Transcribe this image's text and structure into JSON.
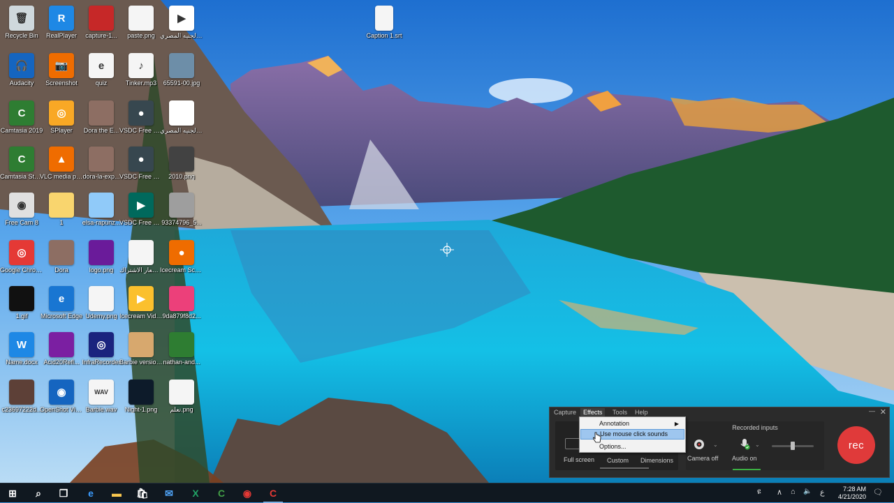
{
  "desktop_icons": [
    {
      "label": "Recycle Bin",
      "icon": "recycle-bin-icon",
      "color": "#cfd8dc",
      "glyph": "🗑"
    },
    {
      "label": "RealPlayer",
      "icon": "realplayer-icon",
      "color": "#1e88e5",
      "glyph": "R"
    },
    {
      "label": "capture-1...",
      "icon": "image-file-icon",
      "color": "#c62828",
      "glyph": ""
    },
    {
      "label": "paste.png",
      "icon": "image-file-icon",
      "color": "#f5f5f5",
      "glyph": ""
    },
    {
      "label": "الجنيه المصري.wmv",
      "icon": "video-file-icon",
      "color": "#ffffff",
      "glyph": "▶"
    },
    {
      "label": "Audacity",
      "icon": "audacity-icon",
      "color": "#1565c0",
      "glyph": "🎧"
    },
    {
      "label": "Screenshot",
      "icon": "screenshot-icon",
      "color": "#ef6c00",
      "glyph": "📷"
    },
    {
      "label": "quiz",
      "icon": "quiz-file-icon",
      "color": "#f5f5f5",
      "glyph": "e"
    },
    {
      "label": "Tinker.mp3",
      "icon": "audio-file-icon",
      "color": "#f5f5f5",
      "glyph": "♪"
    },
    {
      "label": "65591-00.jpg",
      "icon": "image-file-icon",
      "color": "#6d8ea8",
      "glyph": ""
    },
    {
      "label": "Camtasia 2019",
      "icon": "camtasia-icon",
      "color": "#2e7d32",
      "glyph": "C"
    },
    {
      "label": "SPlayer",
      "icon": "splayer-icon",
      "color": "#f9a825",
      "glyph": "◎"
    },
    {
      "label": "Dora the E...",
      "icon": "video-file-icon",
      "color": "#8d6e63",
      "glyph": ""
    },
    {
      "label": "VSDC Free Screen Rec...",
      "icon": "vsdc-recorder-icon",
      "color": "#37474f",
      "glyph": "●"
    },
    {
      "label": "الجنيه المصري.mov",
      "icon": "video-file-icon",
      "color": "#ffffff",
      "glyph": ""
    },
    {
      "label": "Camtasia Studio 8",
      "icon": "camtasia-studio-icon",
      "color": "#2e7d32",
      "glyph": "C"
    },
    {
      "label": "VLC media player",
      "icon": "vlc-icon",
      "color": "#ef6c00",
      "glyph": "▲"
    },
    {
      "label": "dora-la-exp...",
      "icon": "image-file-icon",
      "color": "#8d6e63",
      "glyph": ""
    },
    {
      "label": "VSDC Free Video Ca...",
      "icon": "vsdc-capture-icon",
      "color": "#37474f",
      "glyph": "●"
    },
    {
      "label": "2010.png",
      "icon": "image-file-icon",
      "color": "#424242",
      "glyph": ""
    },
    {
      "label": "Free Cam 8",
      "icon": "freecam-icon",
      "color": "#e0e0e0",
      "glyph": "◉"
    },
    {
      "label": "1",
      "icon": "folder-icon",
      "color": "#f9d56e",
      "glyph": ""
    },
    {
      "label": "elsa-rapunz...",
      "icon": "image-file-icon",
      "color": "#90caf9",
      "glyph": ""
    },
    {
      "label": "VSDC Free Video Edit...",
      "icon": "vsdc-editor-icon",
      "color": "#00695c",
      "glyph": "▶"
    },
    {
      "label": "93374796_5...",
      "icon": "image-file-icon",
      "color": "#9e9e9e",
      "glyph": ""
    },
    {
      "label": "Google Chrome",
      "icon": "chrome-icon",
      "color": "#e53935",
      "glyph": "◎"
    },
    {
      "label": "Dora",
      "icon": "image-file-icon",
      "color": "#8d6e63",
      "glyph": ""
    },
    {
      "label": "logo.png",
      "icon": "image-file-icon",
      "color": "#6a1b9a",
      "glyph": ""
    },
    {
      "label": "شعار الاشتراك.png",
      "icon": "image-file-icon",
      "color": "#f5f5f5",
      "glyph": ""
    },
    {
      "label": "Icecream Screen ...",
      "icon": "icecream-screen-icon",
      "color": "#ef6c00",
      "glyph": "●"
    },
    {
      "label": "1.gif",
      "icon": "image-file-icon",
      "color": "#111111",
      "glyph": ""
    },
    {
      "label": "Microsoft Edge",
      "icon": "edge-icon",
      "color": "#1976d2",
      "glyph": "e"
    },
    {
      "label": "Udemy.png",
      "icon": "image-file-icon",
      "color": "#f5f5f5",
      "glyph": ""
    },
    {
      "label": "Icecream Video Editor",
      "icon": "icecream-video-icon",
      "color": "#fbc02d",
      "glyph": "▶"
    },
    {
      "label": "9da879f8d2...",
      "icon": "image-file-icon",
      "color": "#ec407a",
      "glyph": ""
    },
    {
      "label": "Name.docx",
      "icon": "word-file-icon",
      "color": "#1e88e5",
      "glyph": "W"
    },
    {
      "label": "Acid20Refl...",
      "icon": "image-file-icon",
      "color": "#7b1fa2",
      "glyph": ""
    },
    {
      "label": "InfraRecorder",
      "icon": "infrarecorder-icon",
      "color": "#1a237e",
      "glyph": "◎"
    },
    {
      "label": "Barbie version.png",
      "icon": "image-file-icon",
      "color": "#d7a86e",
      "glyph": ""
    },
    {
      "label": "nathan-and...",
      "icon": "image-file-icon",
      "color": "#2e7d32",
      "glyph": ""
    },
    {
      "label": "c23697222d...",
      "icon": "image-file-icon",
      "color": "#5d4037",
      "glyph": ""
    },
    {
      "label": "OpenShot Video Editor",
      "icon": "openshot-icon",
      "color": "#1565c0",
      "glyph": "◉"
    },
    {
      "label": "Barbie.wav",
      "icon": "audio-file-icon",
      "color": "#f5f5f5",
      "glyph": "WAV"
    },
    {
      "label": "Night-1.png",
      "icon": "image-file-icon",
      "color": "#0d1b2a",
      "glyph": ""
    },
    {
      "label": "تعلم.png",
      "icon": "image-file-icon",
      "color": "#f5f5f5",
      "glyph": ""
    }
  ],
  "extra_icon": {
    "label": "Caption 1.srt",
    "icon": "text-file-icon",
    "color": "#f5f5f5"
  },
  "recorder": {
    "menus": [
      "Capture",
      "Effects",
      "Tools",
      "Help"
    ],
    "active_menu": "Effects",
    "recorded_inputs_title": "Recorded inputs",
    "full_screen_label": "Full screen",
    "custom_label": "Custom",
    "dimensions_label": "Dimensions",
    "camera_label": "Camera off",
    "audio_label": "Audio on",
    "rec_label": "rec",
    "rec_color": "#e03a3a",
    "volume_level": 0.5
  },
  "effects_menu": {
    "items": [
      {
        "label": "Annotation",
        "has_submenu": true
      },
      {
        "label": "Use mouse click sounds",
        "highlighted": true
      },
      {
        "label": "Options..."
      }
    ],
    "submenu_arrow": "▶"
  },
  "taskbar": {
    "apps": [
      {
        "name": "start-button",
        "glyph": "⊞",
        "color": "#ffffff"
      },
      {
        "name": "search-icon",
        "glyph": "⌕",
        "color": "#ffffff"
      },
      {
        "name": "task-view-icon",
        "glyph": "❐",
        "color": "#ffffff"
      },
      {
        "name": "edge-taskbar-icon",
        "glyph": "e",
        "color": "#3b9cff"
      },
      {
        "name": "file-explorer-icon",
        "glyph": "▬",
        "color": "#f9c74f"
      },
      {
        "name": "store-icon",
        "glyph": "🛍",
        "color": "#ffffff"
      },
      {
        "name": "mail-icon",
        "glyph": "✉",
        "color": "#4fa3f7"
      },
      {
        "name": "excel-icon",
        "glyph": "X",
        "color": "#21a366"
      },
      {
        "name": "camtasia-taskbar-icon",
        "glyph": "C",
        "color": "#43a047"
      },
      {
        "name": "chrome-taskbar-icon",
        "glyph": "◉",
        "color": "#e53935"
      },
      {
        "name": "camtasia-recorder-taskbar-icon",
        "glyph": "C",
        "color": "#e53935"
      }
    ],
    "active_app": "camtasia-recorder-taskbar-icon",
    "tray": {
      "people": "ዩ",
      "chevron": "∧",
      "network": "⌂",
      "volume": "🔈",
      "input": "ع"
    },
    "time": "7:28 AM",
    "date": "4/21/2020",
    "notifications": "🗨"
  }
}
